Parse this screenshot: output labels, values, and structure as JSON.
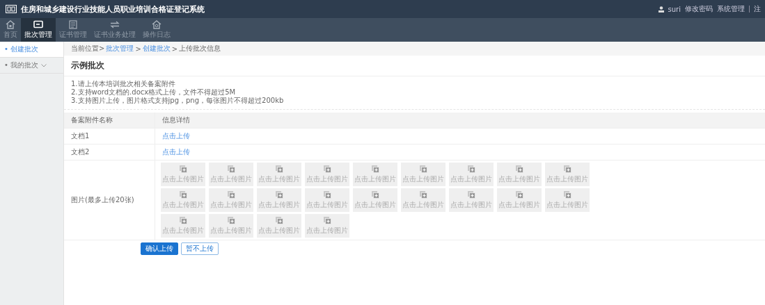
{
  "header": {
    "title": "住房和城乡建设行业技能人员职业培训合格证登记系统",
    "user": "suri",
    "links": [
      "修改密码",
      "系统管理",
      "注"
    ]
  },
  "nav": [
    {
      "label": "首页",
      "kind": "home",
      "selected": false
    },
    {
      "label": "批次管理",
      "kind": "screen",
      "selected": true
    },
    {
      "label": "证书管理",
      "kind": "doc",
      "selected": false
    },
    {
      "label": "证书业务处理",
      "kind": "swap",
      "selected": false
    },
    {
      "label": "操作日志",
      "kind": "house",
      "selected": false
    }
  ],
  "sidebar": {
    "items": [
      {
        "label": "• 创建批次",
        "selected": true
      },
      {
        "label": "• 我的批次",
        "selected": false,
        "expandable": true
      }
    ]
  },
  "breadcrumb": [
    {
      "text": "当前位置>",
      "kind": "text"
    },
    {
      "text": "批次管理",
      "kind": "link"
    },
    {
      "text": ">",
      "kind": "text"
    },
    {
      "text": "创建批次",
      "kind": "link"
    },
    {
      "text": ">",
      "kind": "text"
    },
    {
      "text": "上传批次信息",
      "kind": "text"
    }
  ],
  "page_title": "示例批次",
  "notes": [
    "1.请上传本培训批次相关备案附件",
    "2.支持word文档的.docx格式上传，文件不得超过5M",
    "3.支持图片上传，图片格式支持jpg，png，每张图片不得超过200kb"
  ],
  "table": {
    "columns": [
      "备案附件名称",
      "信息详情"
    ],
    "rows": [
      {
        "name": "文档1",
        "kind": "file",
        "action": "点击上传"
      },
      {
        "name": "文档2",
        "kind": "file",
        "action": "点击上传"
      },
      {
        "name": "图片(最多上传20张)",
        "kind": "images",
        "tiles": [
          "点击上传图片",
          "点击上传图片",
          "点击上传图片",
          "点击上传图片",
          "点击上传图片",
          "点击上传图片",
          "点击上传图片",
          "点击上传图片",
          "点击上传图片",
          "点击上传图片",
          "点击上传图片",
          "点击上传图片",
          "点击上传图片",
          "点击上传图片",
          "点击上传图片",
          "点击上传图片",
          "点击上传图片",
          "点击上传图片",
          "点击上传图片",
          "点击上传图片",
          "点击上传图片",
          "点击上传图片"
        ]
      }
    ]
  },
  "buttons": [
    {
      "label": "确认上传",
      "kind": "primary"
    },
    {
      "label": "暂不上传",
      "kind": "secondary"
    }
  ]
}
